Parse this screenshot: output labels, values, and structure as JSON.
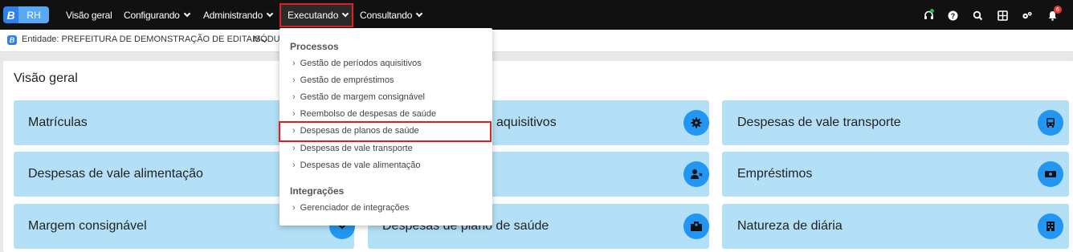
{
  "app": {
    "logo_letter": "B",
    "logo_text": "RH"
  },
  "nav": {
    "items": [
      {
        "label": "Visão geral"
      },
      {
        "label": "Configurando"
      },
      {
        "label": "Administrando"
      },
      {
        "label": "Executando"
      },
      {
        "label": "Consultando"
      }
    ],
    "icons": [
      "headset-icon",
      "help-icon",
      "search-icon",
      "apps-icon",
      "settings-icon",
      "notifications-icon"
    ],
    "notification_count": "6"
  },
  "subheader": {
    "entity_label": "Entidade: PREFEITURA DE DEMONSTRAÇÃO DE EDITAIS",
    "module_label": "MÓDU"
  },
  "main": {
    "title": "Visão geral",
    "cards": [
      {
        "label": "Matrículas",
        "icon": "matriculas-icon"
      },
      {
        "label": "aquisitivos",
        "icon": "settings-icon"
      },
      {
        "label": "Despesas de vale transporte",
        "icon": "bus-icon"
      },
      {
        "label": "Despesas de vale alimentação",
        "icon": "food-icon"
      },
      {
        "label": "",
        "icon": "user-remove-icon"
      },
      {
        "label": "Empréstimos",
        "icon": "money-icon"
      },
      {
        "label": "Margem consignável",
        "icon": "margin-icon"
      },
      {
        "label": "Despesas de plano de saúde",
        "icon": "hospital-icon"
      },
      {
        "label": "Natureza de diária",
        "icon": "building-icon"
      }
    ]
  },
  "dropdown": {
    "sections": [
      {
        "title": "Processos",
        "items": [
          "Gestão de períodos aquisitivos",
          "Gestão de empréstimos",
          "Gestão de margem consignável",
          "Reembolso de despesas de saúde",
          "Despesas de planos de saúde",
          "Despesas de vale transporte",
          "Despesas de vale alimentação"
        ]
      },
      {
        "title": "Integrações",
        "items": [
          "Gerenciador de integrações"
        ]
      }
    ],
    "highlighted_item": "Despesas de planos de saúde"
  },
  "colors": {
    "nav_bg": "#111111",
    "card_bg": "#b3e0f7",
    "icon_bg": "#2196f3",
    "highlight": "#e02020"
  }
}
